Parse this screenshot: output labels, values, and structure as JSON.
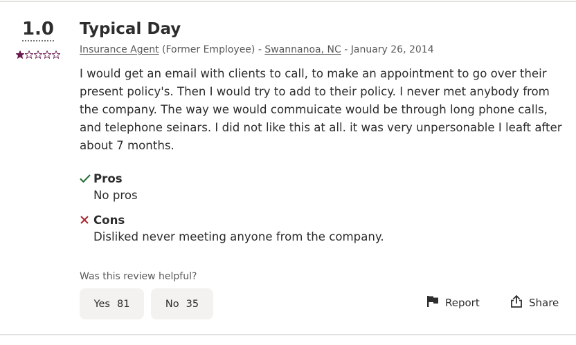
{
  "review": {
    "rating": "1.0",
    "stars_filled": 1,
    "stars_total": 5,
    "title": "Typical Day",
    "job_title": "Insurance Agent",
    "employment_status": "(Former Employee)",
    "separator": "-",
    "location": "Swannanoa, NC",
    "date": "- January 26, 2014",
    "body": "I would get an email with clients to call, to make an appointment to go over their present policy's. Then I would try to add to their policy. I never met anybody from the company. The way we would commuicate would be through long phone calls, and telephone seinars. I did not like this at all. it was very unpersonable I leaft after about 7 months.",
    "pros_label": "Pros",
    "pros_text": "No pros",
    "cons_label": "Cons",
    "cons_text": "Disliked never meeting anyone from the company."
  },
  "feedback": {
    "question": "Was this review helpful?",
    "yes_label": "Yes",
    "yes_count": "81",
    "no_label": "No",
    "no_count": "35"
  },
  "actions": {
    "report_label": "Report",
    "share_label": "Share"
  },
  "icons": {
    "star": "star-icon",
    "pros": "checkmark-icon",
    "cons": "x-icon",
    "report": "flag-icon",
    "share": "share-icon"
  },
  "colors": {
    "star": "#6a1b51",
    "check": "#1f662c",
    "cross": "#a9252b",
    "button_bg": "#f3f2f1",
    "text": "#2d2d2d",
    "muted": "#595959"
  }
}
